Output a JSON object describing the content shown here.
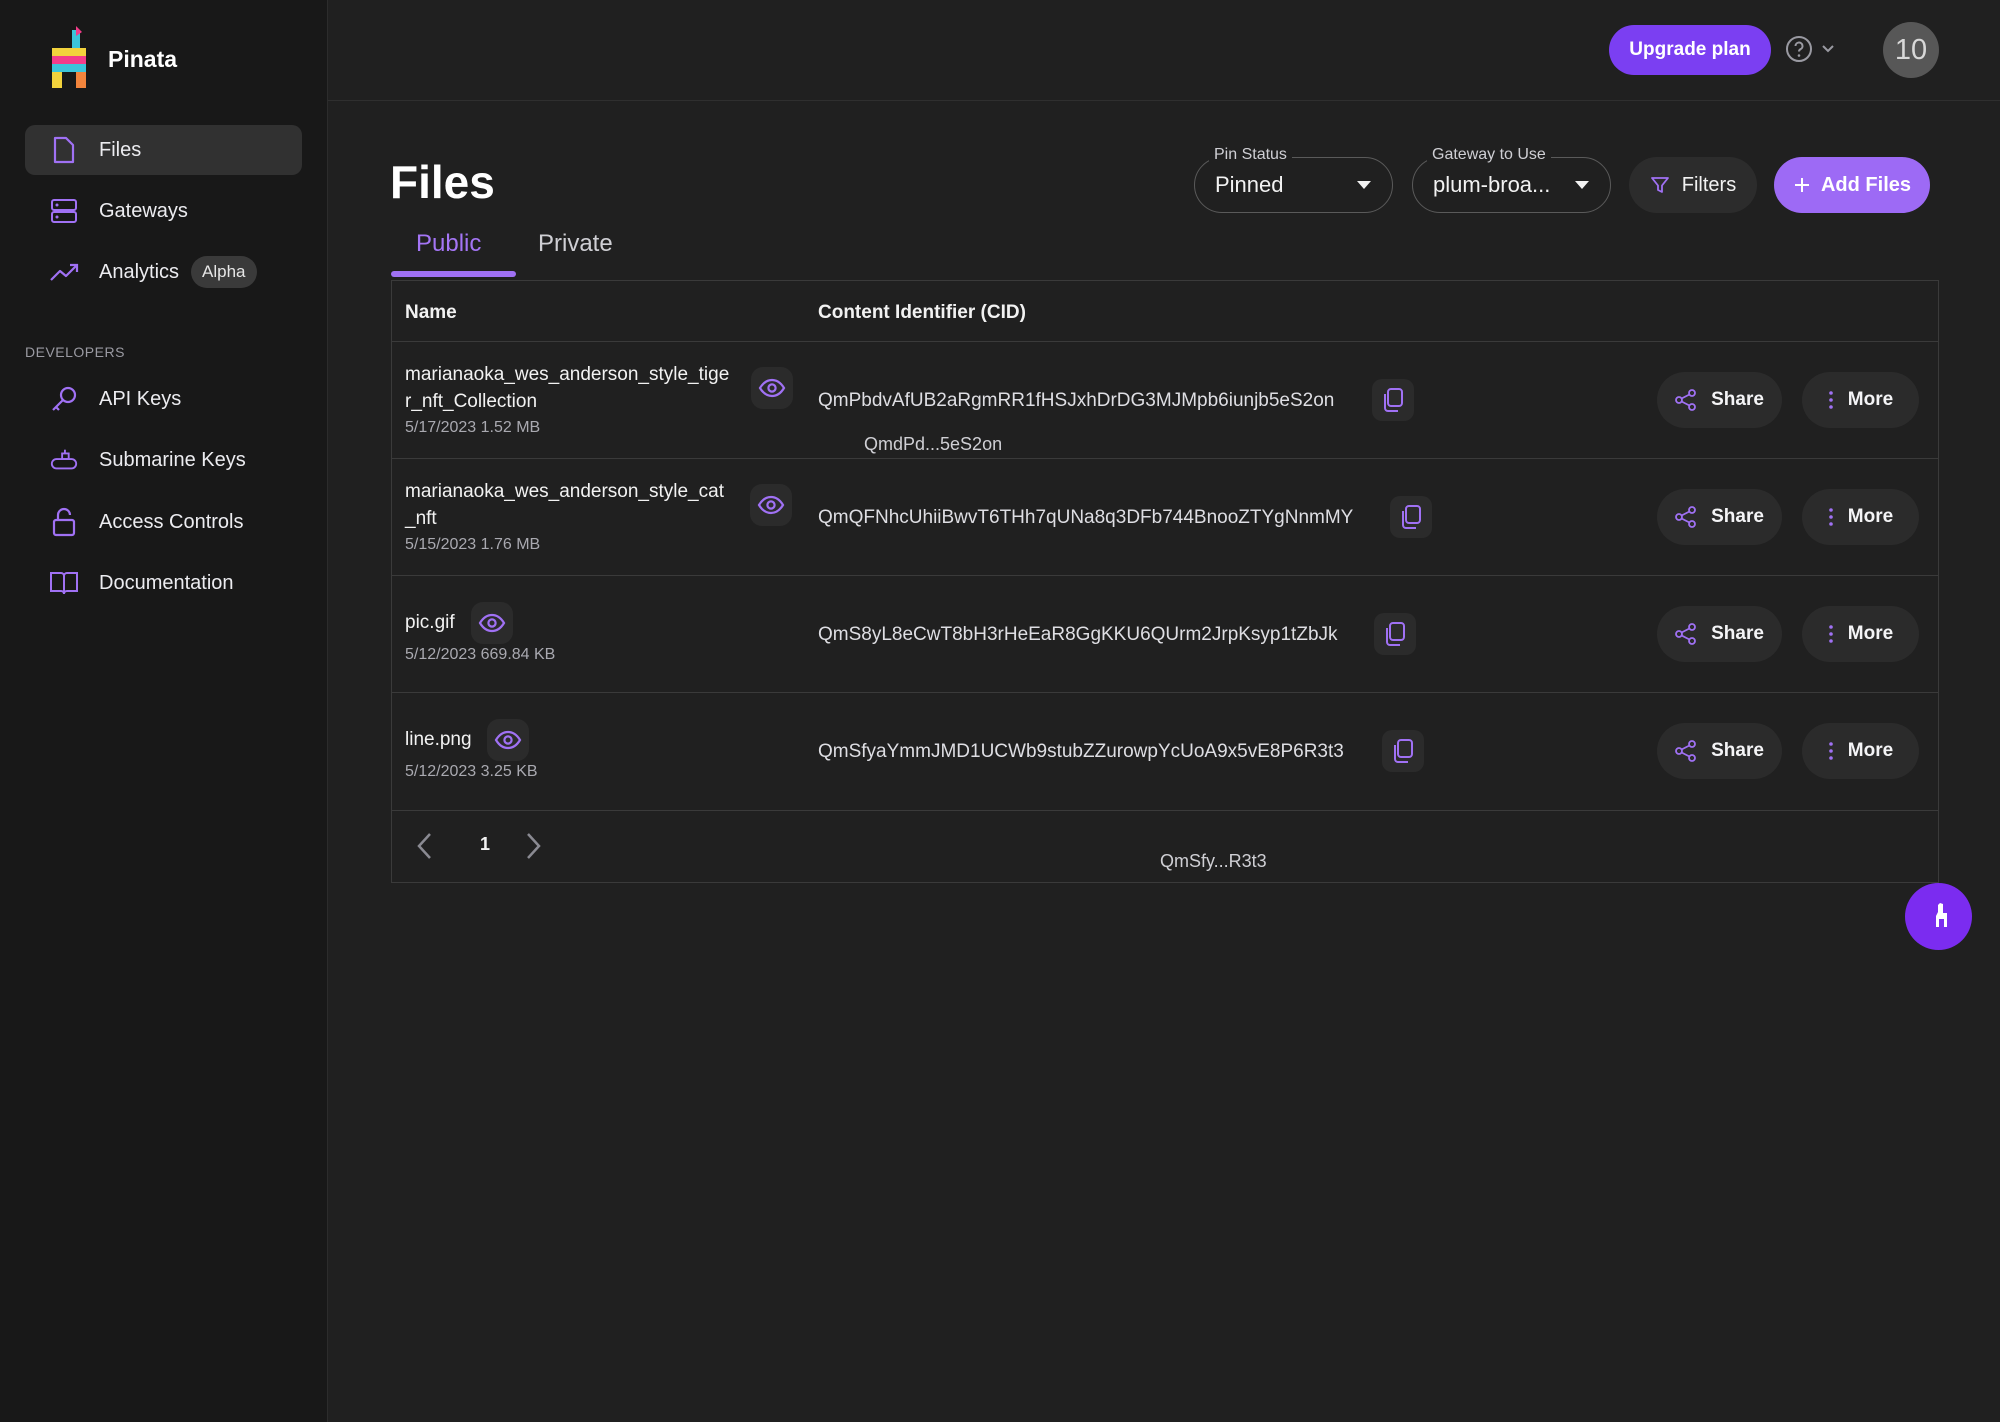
{
  "brand": {
    "name": "Pinata"
  },
  "sidebar": {
    "items": [
      {
        "label": "Files",
        "icon": "file-icon"
      },
      {
        "label": "Gateways",
        "icon": "server-icon"
      },
      {
        "label": "Analytics",
        "icon": "trend-icon",
        "badge": "Alpha"
      }
    ],
    "section_label": "DEVELOPERS",
    "dev_items": [
      {
        "label": "API Keys",
        "icon": "key-icon"
      },
      {
        "label": "Submarine Keys",
        "icon": "submarine-icon"
      },
      {
        "label": "Access Controls",
        "icon": "lock-icon"
      },
      {
        "label": "Documentation",
        "icon": "book-icon"
      }
    ]
  },
  "topbar": {
    "upgrade_label": "Upgrade plan",
    "avatar_text": "10"
  },
  "page": {
    "title": "Files",
    "pin_status": {
      "legend": "Pin Status",
      "value": "Pinned"
    },
    "gateway": {
      "legend": "Gateway to Use",
      "value": "plum-broa..."
    },
    "filters_label": "Filters",
    "add_files_label": "Add Files",
    "tabs": [
      "Public",
      "Private"
    ]
  },
  "table": {
    "headers": [
      "Name",
      "Content Identifier (CID)"
    ],
    "rows": [
      {
        "name_line1": "marianaoka_wes_anderson_style_tige",
        "name_line2": "r_nft_Collection",
        "meta": "5/17/2023 1.52 MB",
        "cid": "QmPbdvAfUB2aRgmRR1fHSJxhDrDG3MJMpb6iunjb5eS2on"
      },
      {
        "name_line1": "marianaoka_wes_anderson_style_cat",
        "name_line2": "_nft",
        "meta": "5/15/2023 1.76 MB",
        "cid": "QmQFNhcUhiiBwvT6THh7qUNa8q3DFb744BnooZTYgNnmMY"
      },
      {
        "name_line1": "pic.gif",
        "name_line2": "",
        "meta": "5/12/2023 669.84 KB",
        "cid": "QmS8yL8eCwT8bH3rHeEaR8GgKKU6QUrm2JrpKsyp1tZbJk"
      },
      {
        "name_line1": "line.png",
        "name_line2": "",
        "meta": "5/12/2023 3.25 KB",
        "cid": "QmSfyaYmmJMD1UCWb9stubZZurowpYcUoA9x5vE8P6R3t3"
      }
    ],
    "share_label": "Share",
    "more_label": "More",
    "tooltip_1": "QmdPd...5eS2on",
    "tooltip_2": "QmSfy...R3t3"
  },
  "pagination": {
    "current_page": "1"
  },
  "colors": {
    "accent": "#9d6af5",
    "upgrade": "#7b3ff2",
    "fab": "#7b2cf0"
  }
}
